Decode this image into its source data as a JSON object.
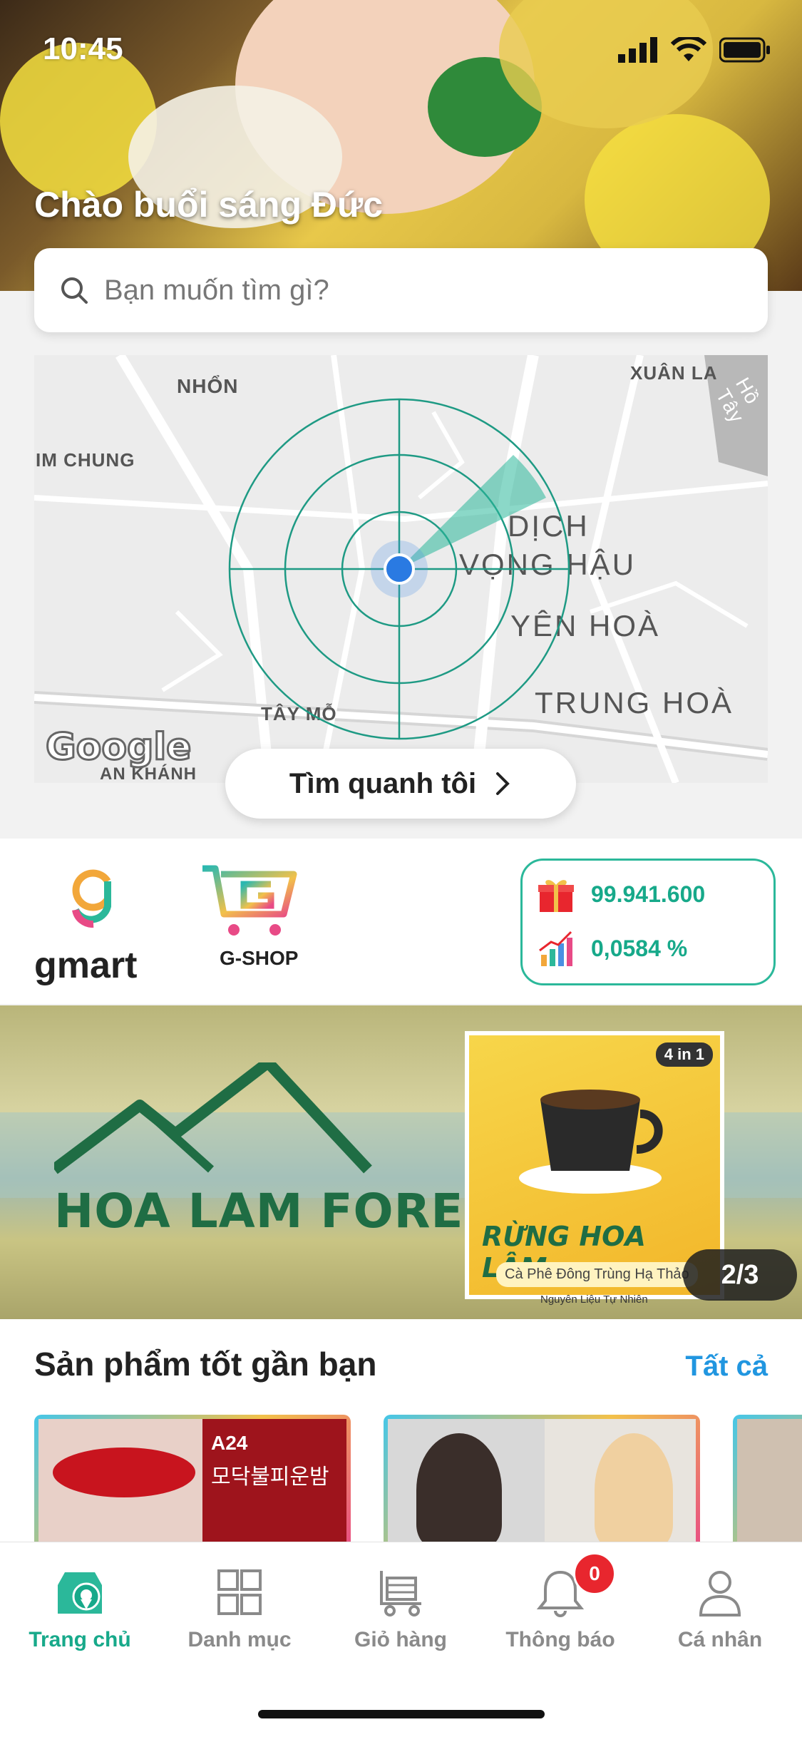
{
  "status_bar": {
    "time": "10:45"
  },
  "header": {
    "greeting": "Chào buổi sáng Đức"
  },
  "search": {
    "placeholder": "Bạn muốn tìm gì?"
  },
  "map": {
    "labels": [
      "NHỔN",
      "XUÂN LA",
      "IM CHUNG",
      "DỊCH",
      "VỌNG HẬU",
      "YÊN HOÀ",
      "TÂY MỖ",
      "TRUNG HOÀ",
      "AN KHÁNH",
      "Hồ Tây"
    ],
    "provider": "Google",
    "near_me_button": "Tìm quanh tôi"
  },
  "brands": {
    "gmart": "gmart",
    "gshop": "G-SHOP"
  },
  "wallet": {
    "points": "99.941.600",
    "rate": "0,0584 %"
  },
  "banner": {
    "brand_text": "HOA LAM FOREST",
    "product_title": "RỪNG HOA LÂM",
    "product_subtitle": "Cà Phê Đông Trùng Hạ Thảo",
    "product_note": "Nguyên Liệu Tự Nhiên",
    "product_badge": "4 in 1",
    "pager": "2/3"
  },
  "section": {
    "title": "Sản phẩm tốt gần bạn",
    "see_all": "Tất cả",
    "card1_tag": "A24",
    "card1_text": "모닥불피운밤"
  },
  "tabs": [
    {
      "label": "Trang chủ",
      "active": true
    },
    {
      "label": "Danh mục"
    },
    {
      "label": "Giỏ hàng"
    },
    {
      "label": "Thông báo",
      "badge": "0"
    },
    {
      "label": "Cá nhân"
    }
  ],
  "colors": {
    "accent": "#17a98a",
    "link": "#2196e0",
    "badge": "#e8262e"
  }
}
